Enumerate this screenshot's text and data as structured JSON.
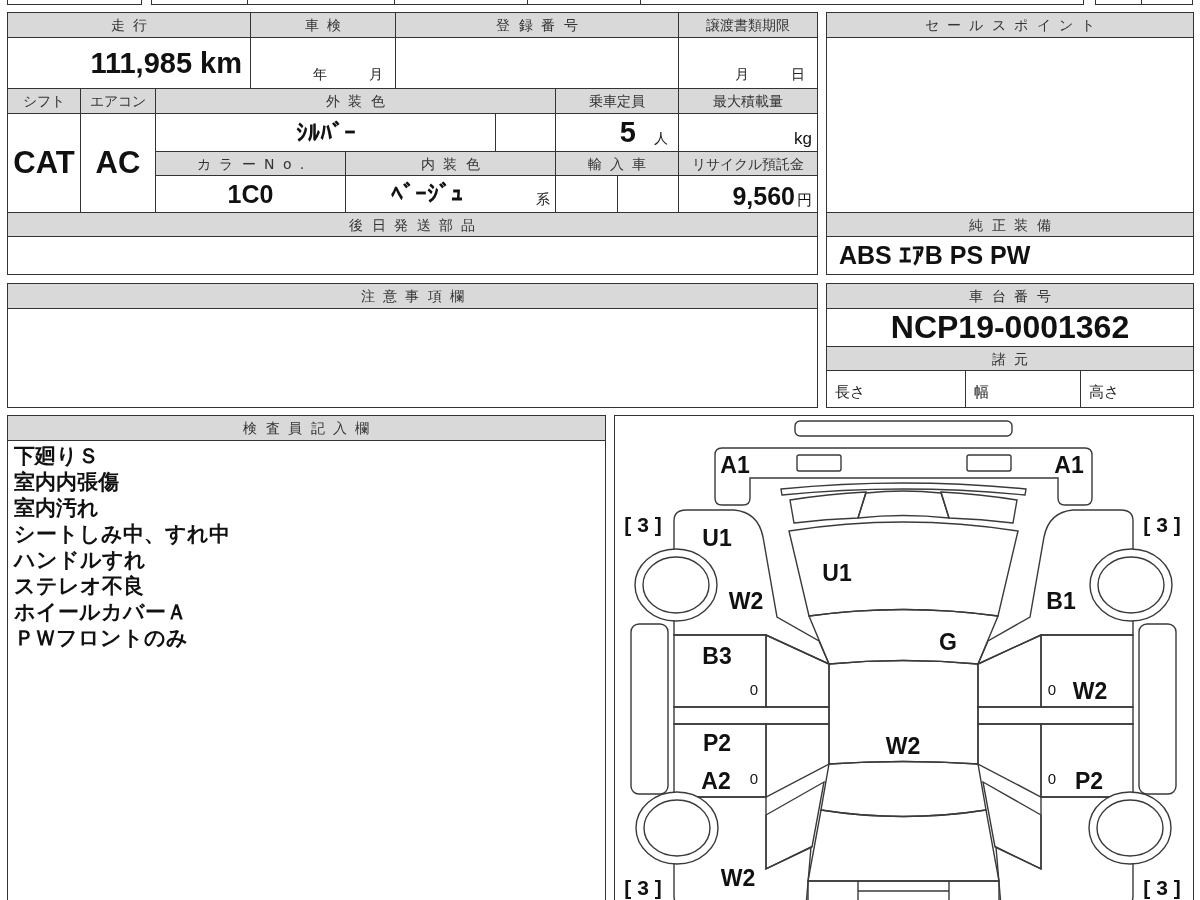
{
  "vehicle_info": {
    "mileage": {
      "label": "走行",
      "value": "111,985 km"
    },
    "inspection": {
      "label": "車検",
      "year_unit": "年",
      "month_unit": "月"
    },
    "registration_number": {
      "label": "登録番号"
    },
    "transfer_deadline": {
      "label": "譲渡書類期限",
      "month_unit": "月",
      "day_unit": "日"
    },
    "shift": {
      "label": "シフト",
      "value": "CAT"
    },
    "air_conditioner": {
      "label": "エアコン",
      "value": "AC"
    },
    "exterior_color": {
      "label": "外装色",
      "value": "ｼﾙﾊﾞｰ"
    },
    "seating_capacity": {
      "label": "乗車定員",
      "value": "5",
      "unit": "人"
    },
    "max_load": {
      "label": "最大積載量",
      "unit": "kg"
    },
    "color_number": {
      "label": "カラーNo.",
      "value": "1C0"
    },
    "interior_color": {
      "label": "内装色",
      "value": "ﾍﾞｰｼﾞｭ",
      "suffix": "系"
    },
    "imported": {
      "label": "輸入車"
    },
    "recycling_deposit": {
      "label": "リサイクル預託金",
      "value": "9,560",
      "unit": "円"
    },
    "parts_shipped_later": {
      "label": "後日発送部品"
    }
  },
  "sales_points": {
    "title": "セールスポイント"
  },
  "standard_equipment": {
    "title": "純正装備",
    "value": "ABS ｴｱB PS PW"
  },
  "caution_notes": {
    "title": "注意事項欄"
  },
  "chassis": {
    "title": "車台番号",
    "value": "NCP19-0001362",
    "specs_title": "諸元",
    "specs": [
      "長さ",
      "幅",
      "高さ"
    ]
  },
  "inspector_notes": {
    "title": "検査員記入欄",
    "lines": [
      "下廻りＳ",
      "室内内張傷",
      "室内汚れ",
      "シートしみ中、すれ中",
      "ハンドルすれ",
      "ステレオ不良",
      "ホイールカバーＡ",
      "ＰＷフロントのみ"
    ]
  },
  "condition_diagram": {
    "front_bumper_left": "A1",
    "front_bumper_right": "A1",
    "front_left_tire": "[ 3 ]",
    "front_right_tire": "[ 3 ]",
    "left_front_fender_upper": "U1",
    "hood": "U1",
    "left_front_fender_lower": "W2",
    "right_front_fender": "B1",
    "windshield": "G",
    "left_front_door": "B3",
    "left_front_door_note": "0",
    "right_front_door_note": "0",
    "right_front_door": "W2",
    "left_rear_door_upper": "P2",
    "roof": "W2",
    "left_rear_door_note": "0",
    "left_rear_door_lower": "A2",
    "right_rear_door_note": "0",
    "right_rear_door": "P2",
    "left_rear_fender": "W2",
    "rear_left_tire": "[ 3 ]",
    "rear_right_tire": "[ 3 ]"
  }
}
